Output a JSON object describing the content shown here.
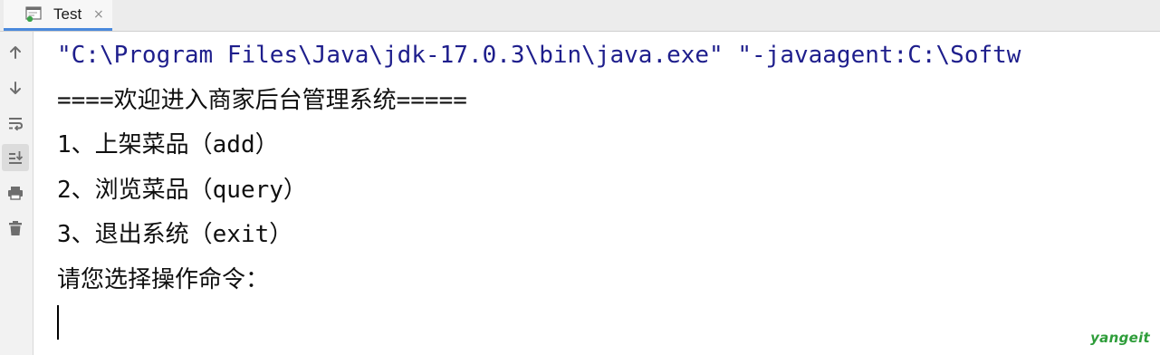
{
  "tab": {
    "label": "Test",
    "close_glyph": "×",
    "icon": "console-window-icon"
  },
  "toolbar": {
    "items": [
      {
        "name": "up-arrow-icon",
        "label": "Up"
      },
      {
        "name": "down-arrow-icon",
        "label": "Down"
      },
      {
        "name": "soft-wrap-icon",
        "label": "Soft-wrap"
      },
      {
        "name": "scroll-to-end-icon",
        "label": "Scroll to the end",
        "active": true
      },
      {
        "name": "print-icon",
        "label": "Print"
      },
      {
        "name": "trash-icon",
        "label": "Clear All"
      }
    ]
  },
  "console": {
    "lines": [
      "\"C:\\Program Files\\Java\\jdk-17.0.3\\bin\\java.exe\" \"-javaagent:C:\\Softw",
      "====欢迎进入商家后台管理系统=====",
      "1、上架菜品（add）",
      "2、浏览菜品（query）",
      "3、退出系统（exit）",
      "请您选择操作命令："
    ]
  },
  "watermark": "yangeit",
  "colors": {
    "tab_underline": "#4a89dc",
    "command_text": "#1e1e8c",
    "output_text": "#0f0f0f",
    "watermark": "#2e9d3a"
  }
}
